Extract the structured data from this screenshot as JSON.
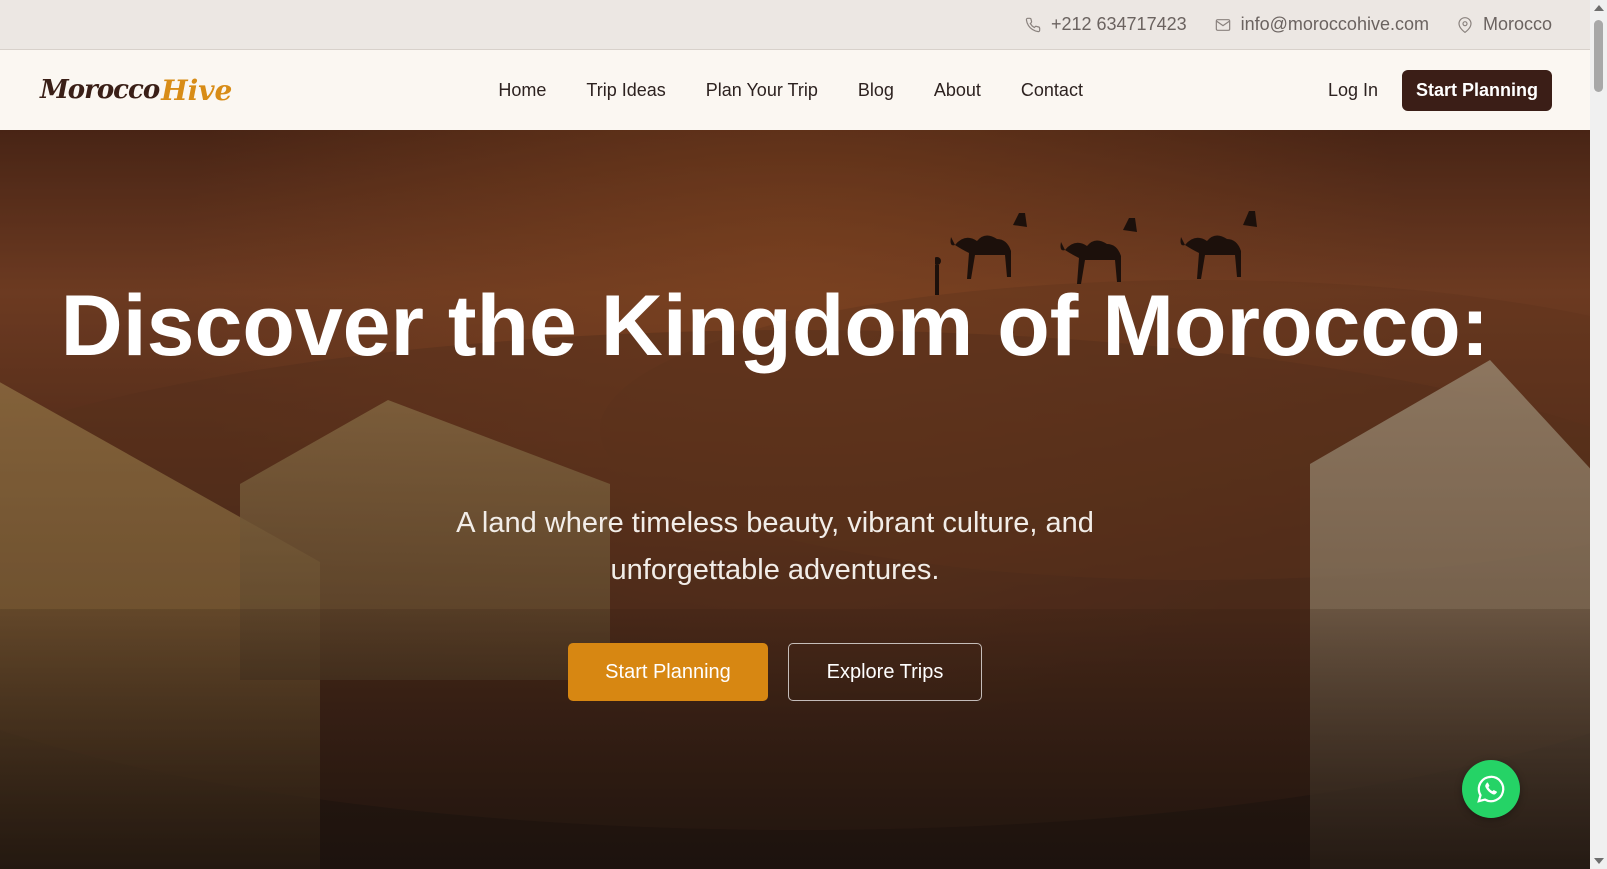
{
  "topbar": {
    "phone": "+212 634717423",
    "email": "info@moroccohive.com",
    "location": "Morocco"
  },
  "nav": {
    "logo_part1": "Morocco",
    "logo_part2": "Hive",
    "items": [
      {
        "label": "Home"
      },
      {
        "label": "Trip Ideas"
      },
      {
        "label": "Plan Your Trip"
      },
      {
        "label": "Blog"
      },
      {
        "label": "About"
      },
      {
        "label": "Contact"
      }
    ],
    "login_label": "Log In",
    "cta_label": "Start Planning"
  },
  "hero": {
    "title": "Discover the Kingdom of Morocco:",
    "subtitle_line1": "A land where timeless beauty, vibrant culture, and",
    "subtitle_line2": "unforgettable adventures.",
    "primary_cta": "Start Planning",
    "secondary_cta": "Explore Trips"
  },
  "icons": {
    "phone": "phone-icon",
    "email": "mail-icon",
    "location": "map-pin-icon",
    "whatsapp": "whatsapp-icon"
  },
  "colors": {
    "accent_orange": "#d78712",
    "brand_dark": "#3b1e17",
    "whatsapp_green": "#25d366"
  }
}
